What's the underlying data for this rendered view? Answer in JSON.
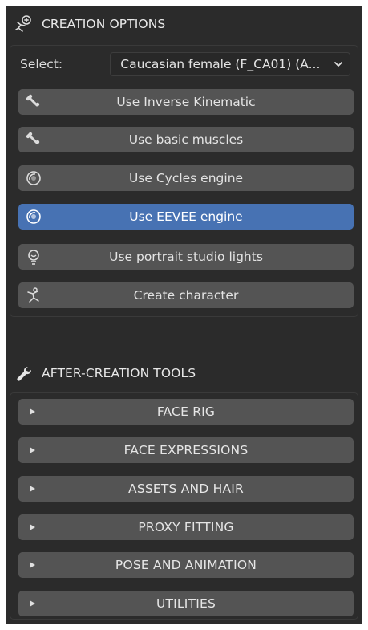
{
  "creation": {
    "title": "CREATION OPTIONS",
    "icon": "add-character-icon",
    "select_label": "Select:",
    "select_value": "Caucasian female (F_CA01) (A...",
    "buttons": [
      {
        "label": "Use Inverse Kinematic",
        "icon": "bone-icon",
        "active": false
      },
      {
        "label": "Use basic muscles",
        "icon": "bone-icon",
        "active": false
      },
      {
        "label": "Use Cycles engine",
        "icon": "render-engine-icon",
        "active": false
      },
      {
        "label": "Use EEVEE engine",
        "icon": "render-engine-icon",
        "active": true
      },
      {
        "label": "Use portrait studio lights",
        "icon": "light-bulb-icon",
        "active": false
      },
      {
        "label": "Create character",
        "icon": "armature-figure-icon",
        "active": false
      }
    ]
  },
  "after_creation": {
    "title": "AFTER-CREATION TOOLS",
    "icon": "wrench-icon",
    "subpanels": [
      {
        "label": "FACE RIG",
        "icon": "disclosure-triangle-icon"
      },
      {
        "label": "FACE EXPRESSIONS",
        "icon": "disclosure-triangle-icon"
      },
      {
        "label": "ASSETS AND HAIR",
        "icon": "disclosure-triangle-icon"
      },
      {
        "label": "PROXY FITTING",
        "icon": "disclosure-triangle-icon"
      },
      {
        "label": "POSE AND ANIMATION",
        "icon": "disclosure-triangle-icon"
      },
      {
        "label": "UTILITIES",
        "icon": "disclosure-triangle-icon"
      }
    ]
  },
  "colors": {
    "panel_bg": "#2b2b2b",
    "button_bg": "#545454",
    "active_button_bg": "#4772b3",
    "text": "#e6e6e6"
  }
}
